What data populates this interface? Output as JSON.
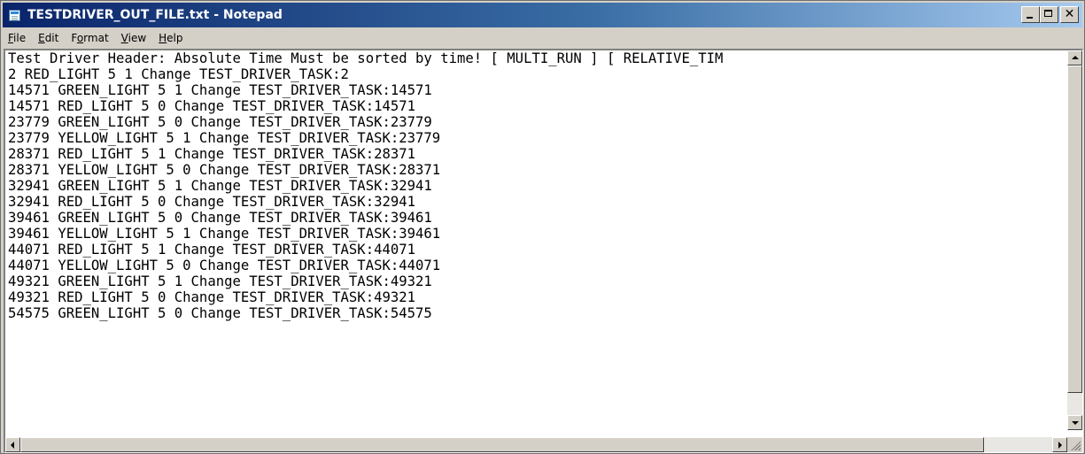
{
  "window": {
    "title": "TESTDRIVER_OUT_FILE.txt - Notepad",
    "caption_buttons": {
      "minimize_icon": "minimize-icon",
      "maximize_icon": "maximize-icon",
      "close_glyph": "✕"
    }
  },
  "menu": {
    "file": {
      "accel": "F",
      "rest": "ile"
    },
    "edit": {
      "accel": "E",
      "rest": "dit"
    },
    "format": {
      "pre": "F",
      "accel": "o",
      "rest": "rmat"
    },
    "view": {
      "accel": "V",
      "rest": "iew"
    },
    "help": {
      "accel": "H",
      "rest": "elp"
    }
  },
  "document": {
    "lines": [
      "Test Driver Header: Absolute Time Must be sorted by time! [ MULTI_RUN ] [ RELATIVE_TIM",
      "2 RED_LIGHT 5 1 Change TEST_DRIVER_TASK:2",
      "14571 GREEN_LIGHT 5 1 Change TEST_DRIVER_TASK:14571",
      "14571 RED_LIGHT 5 0 Change TEST_DRIVER_TASK:14571",
      "23779 GREEN_LIGHT 5 0 Change TEST_DRIVER_TASK:23779",
      "23779 YELLOW_LIGHT 5 1 Change TEST_DRIVER_TASK:23779",
      "28371 RED_LIGHT 5 1 Change TEST_DRIVER_TASK:28371",
      "28371 YELLOW_LIGHT 5 0 Change TEST_DRIVER_TASK:28371",
      "32941 GREEN_LIGHT 5 1 Change TEST_DRIVER_TASK:32941",
      "32941 RED_LIGHT 5 0 Change TEST_DRIVER_TASK:32941",
      "39461 GREEN_LIGHT 5 0 Change TEST_DRIVER_TASK:39461",
      "39461 YELLOW_LIGHT 5 1 Change TEST_DRIVER_TASK:39461",
      "44071 RED_LIGHT 5 1 Change TEST_DRIVER_TASK:44071",
      "44071 YELLOW_LIGHT 5 0 Change TEST_DRIVER_TASK:44071",
      "49321 GREEN_LIGHT 5 1 Change TEST_DRIVER_TASK:49321",
      "49321 RED_LIGHT 5 0 Change TEST_DRIVER_TASK:49321",
      "54575 GREEN_LIGHT 5 0 Change TEST_DRIVER_TASK:54575"
    ]
  },
  "colors": {
    "titlebar_start": "#0a246a",
    "titlebar_end": "#a6caf0",
    "chrome": "#d4d0c8",
    "text": "#000000",
    "editor_bg": "#ffffff"
  }
}
